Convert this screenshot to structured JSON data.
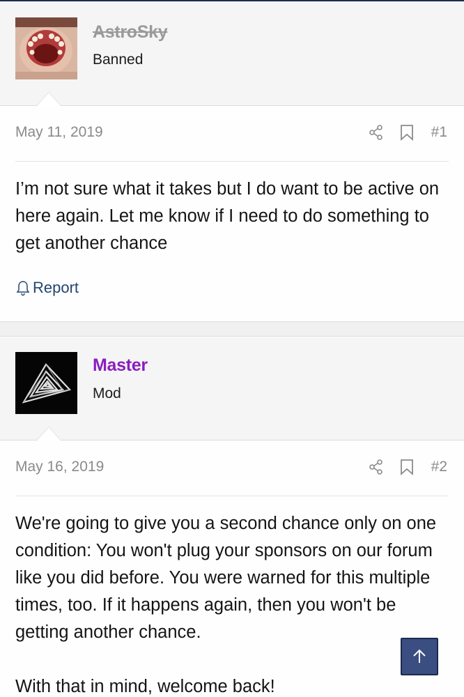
{
  "posts": [
    {
      "author": {
        "name": "AstroSky",
        "title": "Banned",
        "avatar": "mouth-avatar",
        "name_color": "#9a9a9a",
        "banned": true
      },
      "date": "May 11, 2019",
      "post_number": "#1",
      "body": [
        "I’m not sure what it takes but I do want to be active on here again. Let me know if I need to do something to get another chance"
      ],
      "report_label": "Report"
    },
    {
      "author": {
        "name": "Master",
        "title": "Mod",
        "avatar": "triangle-avatar",
        "name_color": "#8a1ec0",
        "banned": false
      },
      "date": "May 16, 2019",
      "post_number": "#2",
      "body": [
        "We're going to give you a second chance only on one condition: You won't plug your sponsors on our forum like you did before. You were warned for this multiple times, too. If it happens again, then you won't be getting another chance.",
        "With that in mind, welcome back!"
      ]
    }
  ],
  "icons": {
    "share": "share-icon",
    "bookmark": "bookmark-icon",
    "bell": "bell-icon",
    "scroll_top": "arrow-up-icon"
  },
  "colors": {
    "link": "#23456f",
    "scroll_button": "#3a4e82",
    "mod_name": "#8a1ec0"
  }
}
